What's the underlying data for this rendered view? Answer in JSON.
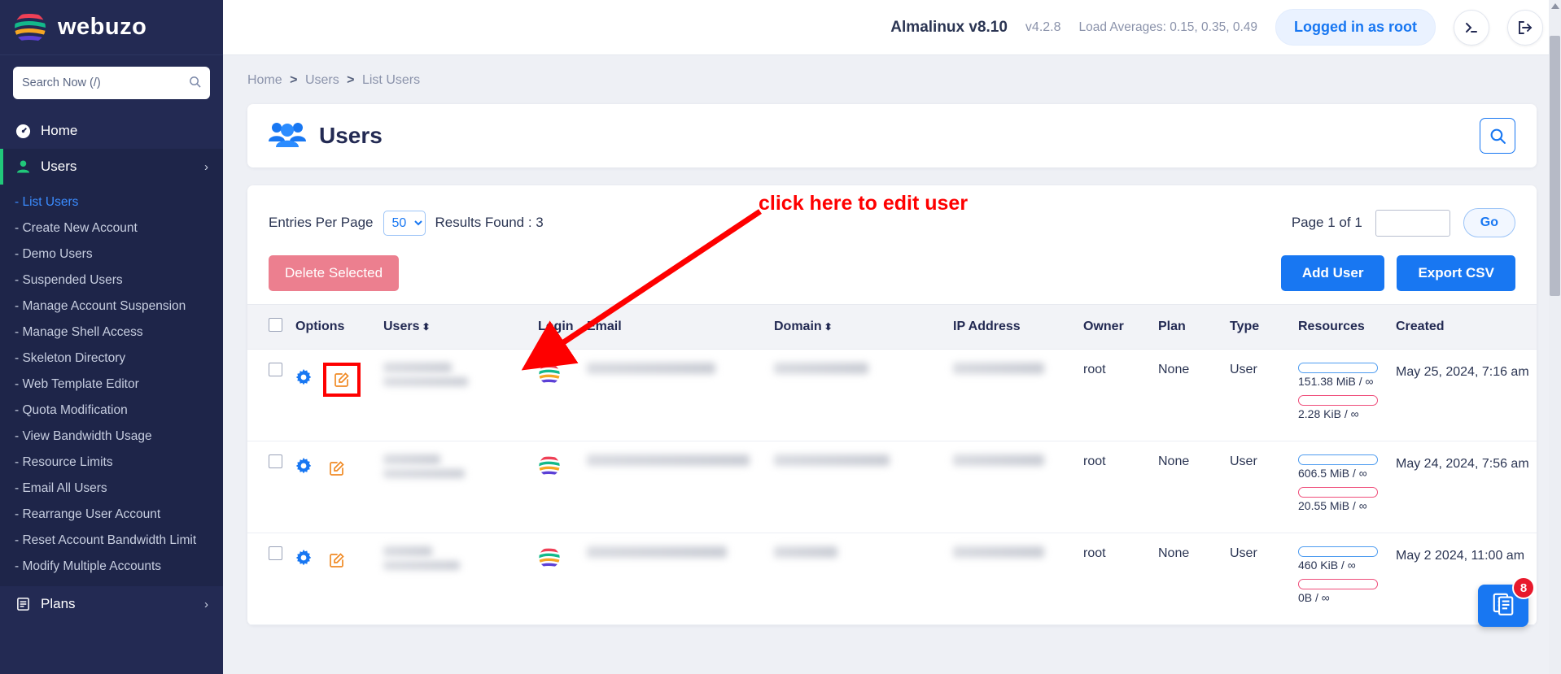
{
  "brand": {
    "name": "webuzo",
    "logo_icon": "webuzo-logo-icon"
  },
  "search": {
    "placeholder": "Search Now (/)",
    "value": "",
    "icon": "search-icon"
  },
  "sidebar": {
    "collapse_icon": "chevron-left-icon",
    "items": [
      {
        "label": "Home",
        "icon": "dashboard-icon"
      },
      {
        "label": "Users",
        "icon": "user-icon",
        "chevron": "chevron-right-icon",
        "active": true
      },
      {
        "label": "Plans",
        "icon": "plans-icon",
        "chevron": "chevron-right-icon"
      }
    ],
    "submenu": [
      {
        "label": "- List Users",
        "current": true
      },
      {
        "label": "- Create New Account"
      },
      {
        "label": "- Demo Users"
      },
      {
        "label": "- Suspended Users"
      },
      {
        "label": "- Manage Account Suspension"
      },
      {
        "label": "- Manage Shell Access"
      },
      {
        "label": "- Skeleton Directory"
      },
      {
        "label": "- Web Template Editor"
      },
      {
        "label": "- Quota Modification"
      },
      {
        "label": "- View Bandwidth Usage"
      },
      {
        "label": "- Resource Limits"
      },
      {
        "label": "- Email All Users"
      },
      {
        "label": "- Rearrange User Account"
      },
      {
        "label": "- Reset Account Bandwidth Limit"
      },
      {
        "label": "- Modify Multiple Accounts"
      }
    ]
  },
  "topbar": {
    "os": "Almalinux v8.10",
    "version": "v4.2.8",
    "load_averages": "Load Averages: 0.15, 0.35, 0.49",
    "login_pill": "Logged in as root",
    "terminal_icon": ">_",
    "logout_icon": "logout-icon"
  },
  "breadcrumb": {
    "items": [
      "Home",
      "Users",
      "List Users"
    ],
    "separator": ">"
  },
  "page": {
    "title": "Users",
    "title_icon": "users-group-icon",
    "search_icon": "search-icon"
  },
  "toolbar": {
    "entries_label": "Entries Per Page",
    "entries_value": "50",
    "entries_options": [
      "50"
    ],
    "results_found": "Results Found : 3",
    "page_label": "Page 1 of 1",
    "page_input_value": "",
    "go_label": "Go",
    "delete_selected": "Delete Selected",
    "add_user": "Add User",
    "export_csv": "Export CSV"
  },
  "table": {
    "columns": [
      {
        "label": "",
        "name": "select-all"
      },
      {
        "label": "Options",
        "name": "options"
      },
      {
        "label": "Users",
        "name": "users",
        "sortable": true
      },
      {
        "label": "Login",
        "name": "login"
      },
      {
        "label": "Email",
        "name": "email"
      },
      {
        "label": "Domain",
        "name": "domain",
        "sortable": true
      },
      {
        "label": "IP Address",
        "name": "ip-address"
      },
      {
        "label": "Owner",
        "name": "owner"
      },
      {
        "label": "Plan",
        "name": "plan"
      },
      {
        "label": "Type",
        "name": "type"
      },
      {
        "label": "Resources",
        "name": "resources"
      },
      {
        "label": "Created",
        "name": "created"
      }
    ],
    "rows": [
      {
        "user": "",
        "email": "",
        "domain": "",
        "ip": "",
        "owner": "root",
        "plan": "None",
        "type": "User",
        "res_disk": "151.38 MiB / ∞",
        "res_bw": "2.28 KiB / ∞",
        "created": "May 25, 2024, 7:16 am",
        "edit_highlighted": true
      },
      {
        "user": "",
        "email": "",
        "domain": "",
        "ip": "",
        "owner": "root",
        "plan": "None",
        "type": "User",
        "res_disk": "606.5 MiB / ∞",
        "res_bw": "20.55 MiB / ∞",
        "created": "May 24, 2024, 7:56 am",
        "edit_highlighted": false
      },
      {
        "user": "",
        "email": "",
        "domain": "",
        "ip": "",
        "owner": "root",
        "plan": "None",
        "type": "User",
        "res_disk": "460 KiB / ∞",
        "res_bw": "0B / ∞",
        "created": "May 2 2024, 11:00 am",
        "edit_highlighted": false
      }
    ]
  },
  "annotation": {
    "text": "click here to edit user",
    "color": "#fe0000"
  },
  "float_widget": {
    "badge": "8",
    "icon": "notes-icon"
  },
  "colors": {
    "sidebar_bg": "#232a53",
    "accent_blue": "#1877f2",
    "green": "#21c87a",
    "danger": "#ec7f8f",
    "orange": "#f08a24",
    "annotation_red": "#fe0000"
  }
}
